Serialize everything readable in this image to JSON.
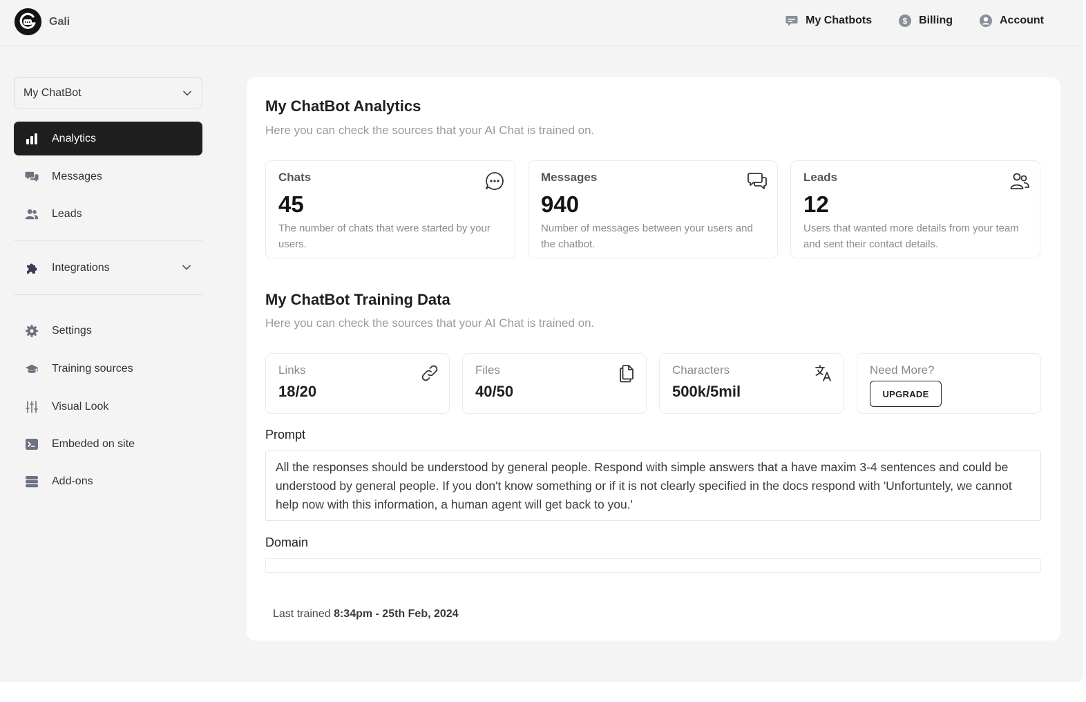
{
  "brand": {
    "name": "Gali"
  },
  "topnav": [
    {
      "label": "My Chatbots",
      "icon": "chat-bubble-icon"
    },
    {
      "label": "Billing",
      "icon": "dollar-coin-icon"
    },
    {
      "label": "Account",
      "icon": "user-circle-icon"
    }
  ],
  "sidebar": {
    "bot_selected": "My ChatBot",
    "items": [
      {
        "label": "Analytics",
        "icon": "bar-chart-icon",
        "active": true
      },
      {
        "label": "Messages",
        "icon": "messages-icon"
      },
      {
        "label": "Leads",
        "icon": "users-icon"
      },
      {
        "label": "Integrations",
        "icon": "puzzle-icon"
      },
      {
        "label": "Settings",
        "icon": "gear-icon"
      },
      {
        "label": "Training sources",
        "icon": "graduation-cap-icon"
      },
      {
        "label": "Visual Look",
        "icon": "sliders-icon"
      },
      {
        "label": "Embeded on site",
        "icon": "terminal-icon"
      },
      {
        "label": "Add-ons",
        "icon": "stack-icon"
      }
    ]
  },
  "analytics": {
    "title": "My ChatBot Analytics",
    "subtitle": "Here you can check the sources that your AI Chat is trained on.",
    "stats": [
      {
        "label": "Chats",
        "value": "45",
        "desc": "The number of chats that were started by your users.",
        "icon": "chat-dots-icon"
      },
      {
        "label": "Messages",
        "value": "940",
        "desc": "Number of messages between your users and the chatbot.",
        "icon": "chat-bubbles-icon"
      },
      {
        "label": "Leads",
        "value": "12",
        "desc": "Users that wanted more details from your team and sent their contact details.",
        "icon": "people-icon"
      }
    ]
  },
  "training": {
    "title": "My ChatBot Training Data",
    "subtitle": "Here you can check the sources that your AI Chat is trained on.",
    "cards": [
      {
        "label": "Links",
        "value": "18/20",
        "icon": "link-icon"
      },
      {
        "label": "Files",
        "value": "40/50",
        "icon": "files-icon"
      },
      {
        "label": "Characters",
        "value": "500k/5mil",
        "icon": "translate-icon"
      }
    ],
    "need_more": {
      "label": "Need More?",
      "button": "UPGRADE"
    },
    "prompt_label": "Prompt",
    "prompt_value": "All the responses should be understood by general people. Respond with simple answers that a have maxim 3-4 sentences and could be understood by general people. If you don't know something or if it is not clearly specified in the docs respond with 'Unfortuntely, we cannot help now with this information, a human agent will get back to you.'",
    "domain_label": "Domain",
    "domain_value": "",
    "last_trained_label": "Last trained",
    "last_trained_value": "8:34pm - 25th Feb, 2024"
  },
  "colors": {
    "accent": "#1f1f1f",
    "background": "#f4f4f4",
    "card": "#ffffff",
    "muted": "#9a9a9a"
  }
}
